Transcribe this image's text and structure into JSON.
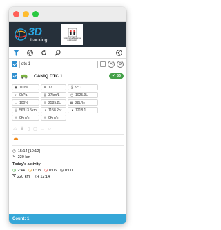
{
  "app": {
    "logo_main": "3D",
    "logo_sub": "tracking",
    "partner_text": "Cooperativa Braidense Autotrasporti"
  },
  "search": {
    "value": "dtc 1"
  },
  "vehicle": {
    "name": "CANiQ DTC 1",
    "badge": "86"
  },
  "metrics": [
    {
      "icon": "fuel-level-icon",
      "glyph": "▣",
      "value": "100%"
    },
    {
      "icon": "wrench-icon",
      "glyph": "✕",
      "value": "17"
    },
    {
      "icon": "thermometer-icon",
      "glyph": "🌡",
      "value": "9°C"
    },
    {
      "icon": "gauge-icon",
      "glyph": "◐",
      "value": "0kPa"
    },
    {
      "icon": "consumption-icon",
      "glyph": "▤",
      "value": "37km/L"
    },
    {
      "icon": "odometer-icon",
      "glyph": "◷",
      "value": "1025.9L"
    },
    {
      "icon": "battery-icon",
      "glyph": "▭",
      "value": "100%"
    },
    {
      "icon": "fuel-used-icon",
      "glyph": "▥",
      "value": "2585.2L"
    },
    {
      "icon": "rate-icon",
      "glyph": "▦",
      "value": "28L/hr"
    },
    {
      "icon": "distance-icon",
      "glyph": "◎",
      "value": "56313.5km"
    },
    {
      "icon": "engine-hours-icon",
      "glyph": "◔",
      "value": "1158.2hr"
    },
    {
      "icon": "rpm-icon",
      "glyph": "◑",
      "value": "1218.1"
    },
    {
      "icon": "speed-icon",
      "glyph": "◎",
      "value": "0Km/h"
    },
    {
      "icon": "speed-limit-icon",
      "glyph": "◎",
      "value": "0Km/h"
    }
  ],
  "last_update": "15:14 [10:12]",
  "distance": "220 km",
  "activity": {
    "title": "Today's activity",
    "items": [
      {
        "color": "#3aa935",
        "value": "2:44"
      },
      {
        "color": "#f0a01c",
        "value": "0:08"
      },
      {
        "color": "#e53935",
        "value": "0:06"
      },
      {
        "color": "#333333",
        "value": "0:00"
      }
    ],
    "distance": "220 km",
    "stop_time": "12:14"
  },
  "footer": {
    "count_label": "Count: 1"
  },
  "colors": {
    "accent": "#35a7d8",
    "header_bg": "#26303a",
    "badge": "#43a047"
  }
}
